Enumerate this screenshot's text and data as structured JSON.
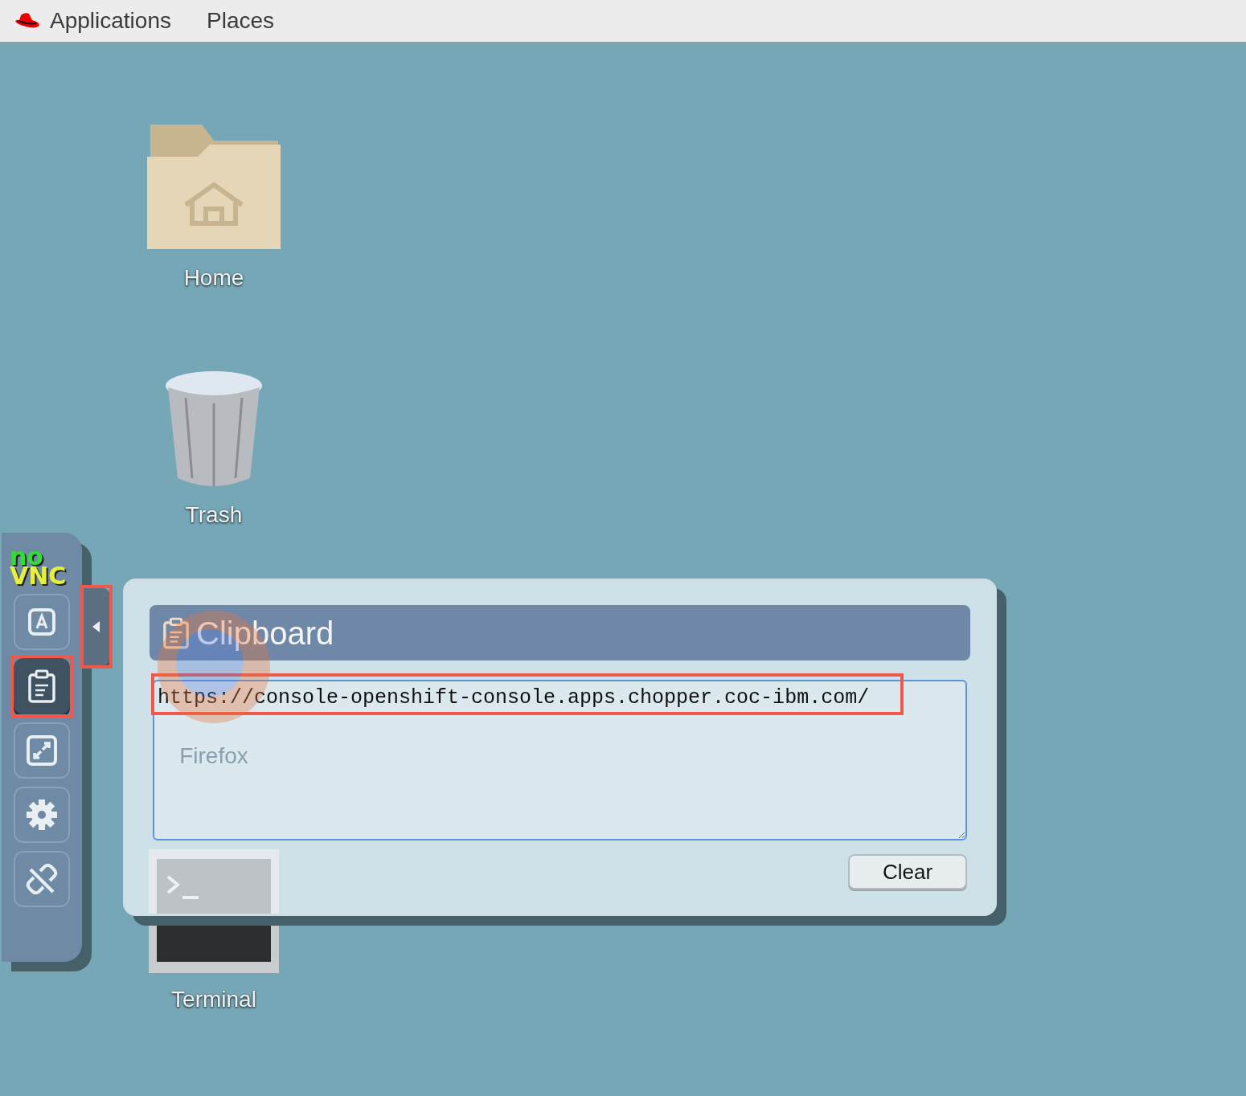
{
  "top_bar": {
    "menus": [
      "Applications",
      "Places"
    ]
  },
  "desktop_icons": [
    {
      "kind": "folder",
      "label": "Home"
    },
    {
      "kind": "trash",
      "label": "Trash"
    },
    {
      "kind": "browser",
      "label": "Firefox"
    },
    {
      "kind": "terminal",
      "label": "Terminal"
    }
  ],
  "novnc": {
    "logo_top": "no",
    "logo_bottom": "VNC",
    "buttons": [
      {
        "kind": "keyboard",
        "selected": false,
        "highlighted": false
      },
      {
        "kind": "clipboard",
        "selected": true,
        "highlighted": true
      },
      {
        "kind": "fullscreen",
        "selected": false,
        "highlighted": false
      },
      {
        "kind": "settings",
        "selected": false,
        "highlighted": false
      },
      {
        "kind": "disconnect",
        "selected": false,
        "highlighted": false
      }
    ],
    "handle": {
      "highlighted": true
    },
    "clipboard_panel": {
      "title": "Clipboard",
      "value": "https://console-openshift-console.apps.chopper.coc-ibm.com/",
      "value_highlighted": true,
      "clear_button": "Clear"
    }
  }
}
